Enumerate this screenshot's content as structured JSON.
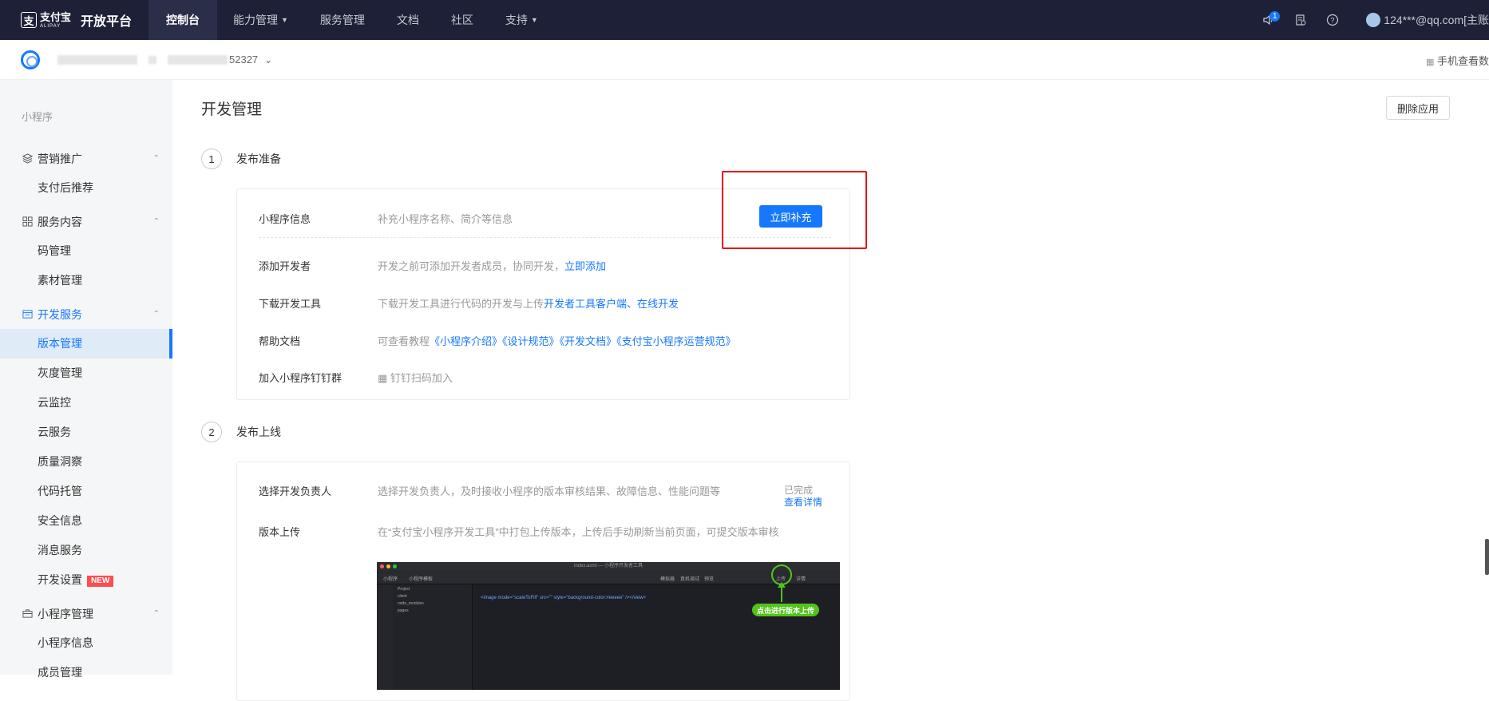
{
  "topnav": {
    "brand_cn": "支付宝",
    "brand_en": "ALIPAY",
    "platform": "开放平台",
    "items": [
      {
        "label": "控制台",
        "active": true,
        "caret": false
      },
      {
        "label": "能力管理",
        "active": false,
        "caret": true
      },
      {
        "label": "服务管理",
        "active": false,
        "caret": false
      },
      {
        "label": "文档",
        "active": false,
        "caret": false
      },
      {
        "label": "社区",
        "active": false,
        "caret": false
      },
      {
        "label": "支持",
        "active": false,
        "caret": true
      }
    ],
    "notification_count": "1",
    "user": "124***@qq.com[主账"
  },
  "appbar": {
    "app_id_suffix": "52327",
    "mobile_link": "手机查看数"
  },
  "sidebar": {
    "title": "小程序",
    "groups": [
      {
        "label": "营销推广",
        "icon": "layers-icon",
        "items": [
          {
            "label": "支付后推荐"
          }
        ]
      },
      {
        "label": "服务内容",
        "icon": "grid-icon",
        "items": [
          {
            "label": "码管理"
          },
          {
            "label": "素材管理"
          }
        ]
      },
      {
        "label": "开发服务",
        "icon": "code-icon",
        "active": true,
        "items": [
          {
            "label": "版本管理",
            "active": true
          },
          {
            "label": "灰度管理"
          },
          {
            "label": "云监控"
          },
          {
            "label": "云服务"
          },
          {
            "label": "质量洞察"
          },
          {
            "label": "代码托管"
          },
          {
            "label": "安全信息"
          },
          {
            "label": "消息服务"
          },
          {
            "label": "开发设置",
            "tag": "NEW"
          }
        ]
      },
      {
        "label": "小程序管理",
        "icon": "briefcase-icon",
        "items": [
          {
            "label": "小程序信息"
          },
          {
            "label": "成员管理"
          }
        ]
      }
    ]
  },
  "main": {
    "title": "开发管理",
    "delete_button": "删除应用",
    "step1": {
      "num": "1",
      "title": "发布准备",
      "rows": {
        "info_label": "小程序信息",
        "info_desc": "补充小程序名称、简介等信息",
        "info_button": "立即补充",
        "dev_label": "添加开发者",
        "dev_desc": "开发之前可添加开发者成员，协同开发，",
        "dev_link": "立即添加",
        "tool_label": "下载开发工具",
        "tool_desc": "下载开发工具进行代码的开发与上传",
        "tool_link1": "开发者工具客户端",
        "tool_sep": "、",
        "tool_link2": "在线开发",
        "doc_label": "帮助文档",
        "doc_desc": "可查看教程",
        "doc_links": [
          "《小程序介绍》",
          "《设计规范》",
          "《开发文档》",
          "《支付宝小程序运营规范》"
        ],
        "group_label": "加入小程序钉钉群",
        "group_link": "钉钉扫码加入"
      }
    },
    "step2": {
      "num": "2",
      "title": "发布上线",
      "owner_label": "选择开发负责人",
      "owner_desc": "选择开发负责人，及时接收小程序的版本审核结果、故障信息、性能问题等",
      "owner_status": "已完成",
      "owner_link": "查看详情",
      "upload_label": "版本上传",
      "upload_desc": "在“支付宝小程序开发工具”中打包上传版本，上传后手动刷新当前页面，可提交版本审核",
      "ide": {
        "window_title": "index.axml — 小程序开发者工具",
        "toolbar_left": "小程序",
        "toolbar_project": "小程序模板",
        "toolbar_right": [
          "模拟器",
          "真机调试",
          "预览",
          "上传",
          "详情"
        ],
        "tree_header": "Project",
        "tree_items": [
          "client",
          "node_modules",
          "pages"
        ],
        "code_line": "<image mode=\"scaleToFill\" src=\"\" style=\"background-color:#eeeee\" /></view>",
        "tip": "点击进行版本上传"
      }
    }
  }
}
